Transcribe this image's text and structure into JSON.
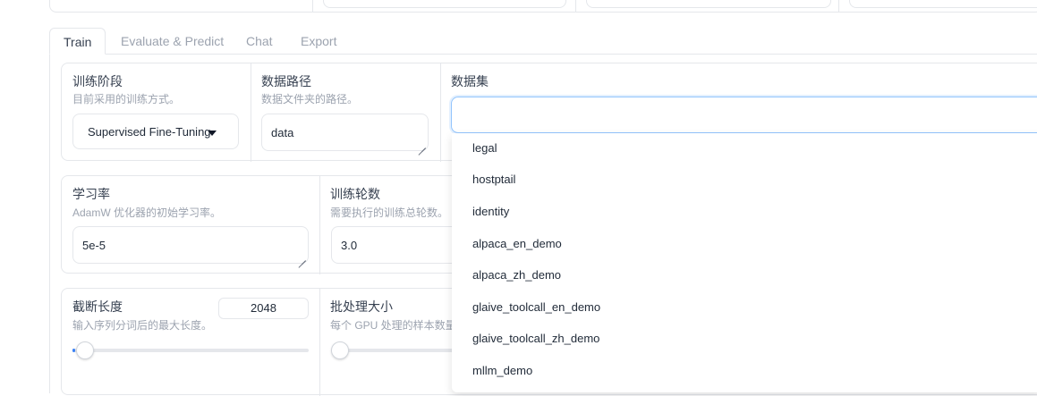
{
  "tabs": [
    "Train",
    "Evaluate & Predict",
    "Chat",
    "Export"
  ],
  "stage": {
    "label": "训练阶段",
    "info": "目前采用的训练方式。",
    "value": "Supervised Fine-Tuning"
  },
  "dataset_dir": {
    "label": "数据路径",
    "info": "数据文件夹的路径。",
    "value": "data"
  },
  "dataset": {
    "label": "数据集",
    "value": "",
    "options": [
      "legal",
      "hostptail",
      "identity",
      "alpaca_en_demo",
      "alpaca_zh_demo",
      "glaive_toolcall_en_demo",
      "glaive_toolcall_zh_demo",
      "mllm_demo"
    ]
  },
  "learning_rate": {
    "label": "学习率",
    "info": "AdamW 优化器的初始学习率。",
    "value": "5e-5"
  },
  "num_epochs": {
    "label": "训练轮数",
    "info": "需要执行的训练总轮数。",
    "value": "3.0"
  },
  "cutoff_len": {
    "label": "截断长度",
    "info": "输入序列分词后的最大长度。",
    "value": "2048",
    "slider_fraction": 0.01
  },
  "batch_size": {
    "label": "批处理大小",
    "info": "每个 GPU 处理的样本数量",
    "slider_fraction": 0.0
  },
  "colors": {
    "accent": "#3b82f6",
    "focus_border": "#93c5fd",
    "border": "#e5e7eb",
    "muted_text": "#9ca3af"
  }
}
